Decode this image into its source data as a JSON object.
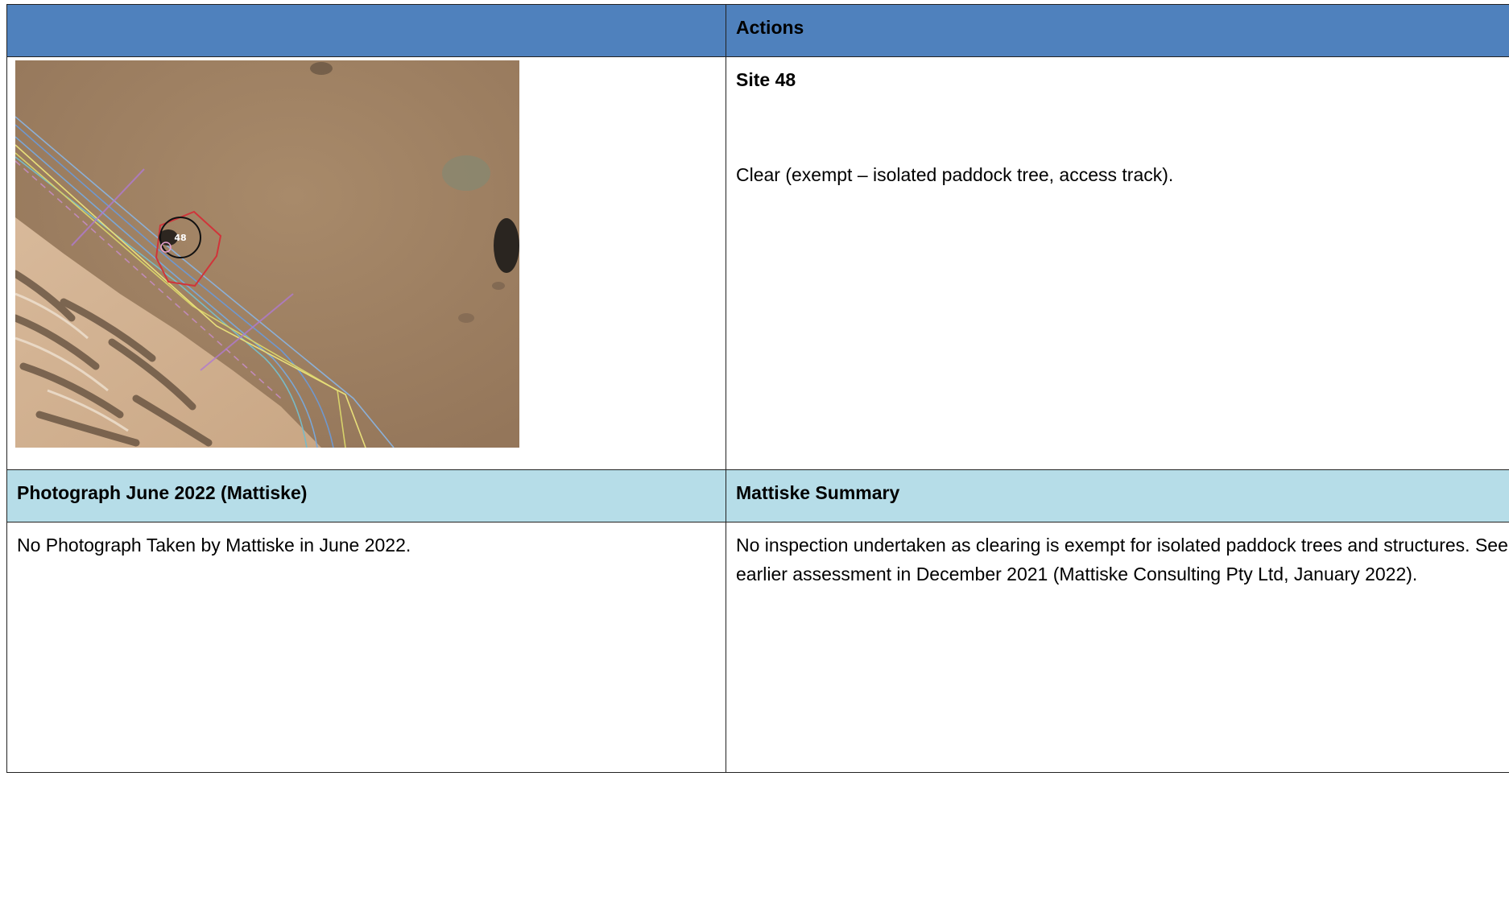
{
  "header_row": {
    "left_label": "",
    "right_label": "Actions"
  },
  "site_row": {
    "image": {
      "kind": "aerial-photo",
      "site_marker_label": "48"
    },
    "site_title": "Site 48",
    "action_text": "Clear (exempt – isolated paddock tree, access track)."
  },
  "section_row": {
    "left_label": "Photograph June 2022 (Mattiske)",
    "right_label": "Mattiske Summary"
  },
  "bottom_row": {
    "photo_note": "No Photograph Taken by Mattiske in June 2022.",
    "summary_text": "No inspection undertaken as clearing is exempt for isolated paddock trees and structures. See earlier assessment in December 2021 (Mattiske Consulting Pty Ltd, January 2022)."
  },
  "colors": {
    "header_blue": "#4f81bd",
    "header_light_blue": "#b6dde8",
    "border": "#222222"
  }
}
